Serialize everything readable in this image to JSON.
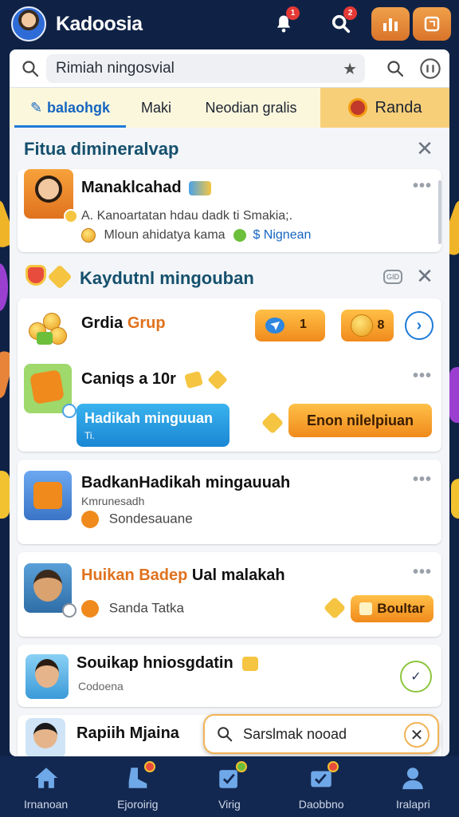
{
  "header": {
    "app_title": "Kadoosia",
    "notification_count": "1",
    "search_count": "2"
  },
  "search": {
    "value": "Rimiah ningosvial"
  },
  "tabs": [
    {
      "label": "balaohgk",
      "active": true
    },
    {
      "label": "Maki",
      "active": false
    },
    {
      "label": "Neodian gralis",
      "active": false
    },
    {
      "label": "Randa",
      "active": false
    }
  ],
  "section1": {
    "title": "Fitua dimineralvap"
  },
  "card1": {
    "title": "Manaklcahad",
    "line1": "A. Kanoartatan hdau dadk ti Smakia;.",
    "line2_a": "Mloun ahidatya kama",
    "line2_b": "$ Nignean"
  },
  "section2": {
    "title": "Kaydutnl mingouban",
    "badge": "GID"
  },
  "card2": {
    "title_a": "Grdia",
    "title_b": "Grup",
    "button_a": "1",
    "button_b": "8"
  },
  "card3": {
    "title": "Caniqs a 10r",
    "button_blue": "Hadikah minguuan",
    "button_blue_sub": "Ti.",
    "button_orange": "Enon nilelpiuan"
  },
  "card4": {
    "title": "BadkanHadikah mingauuah",
    "subtitle": "Kmrunesadh",
    "meta": "Sondesauane"
  },
  "card5": {
    "title_a": "Huikan Badep",
    "title_b": "Ual malakah",
    "meta": "Sanda Tatka",
    "button": "Boultar"
  },
  "card6": {
    "title": "Souikap hniosgdatin",
    "subtitle": "Codoena"
  },
  "card7": {
    "title": "Rapiih Mjaina"
  },
  "float_search": {
    "value": "Sarslmak nooad"
  },
  "nav": [
    {
      "label": "Irnanoan"
    },
    {
      "label": "Ejoroirig"
    },
    {
      "label": "Virig"
    },
    {
      "label": "Daobbno"
    },
    {
      "label": "Iralapri"
    }
  ],
  "colors": {
    "background": "#0f2246",
    "accent_blue": "#1565c0",
    "accent_orange": "#f08a1c",
    "section_title": "#15506d"
  }
}
